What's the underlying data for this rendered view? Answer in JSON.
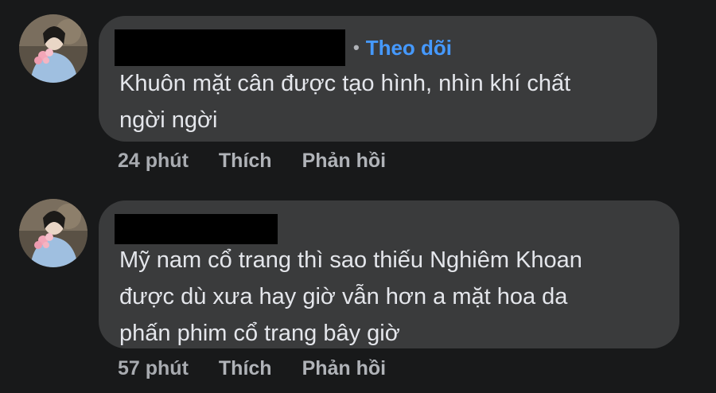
{
  "comments": [
    {
      "author_hidden": true,
      "follow_separator": "•",
      "follow_label": "Theo dõi",
      "text_lines": [
        "Khuôn mặt cân được tạo hình, nhìn khí chất",
        "ngời ngời"
      ],
      "time": "24 phút",
      "like_label": "Thích",
      "reply_label": "Phản hồi"
    },
    {
      "author_hidden": true,
      "text_lines": [
        "Mỹ nam cổ trang thì sao thiếu Nghiêm Khoan",
        "được dù xưa hay giờ vẫn hơn a mặt hoa da",
        "phấn phim cổ trang bây giờ"
      ],
      "time": "57 phút",
      "like_label": "Thích",
      "reply_label": "Phản hồi"
    }
  ],
  "colors": {
    "background": "#18191a",
    "bubble": "#3a3b3c",
    "text": "#e4e6eb",
    "muted": "#b0b3b8",
    "link": "#4599ff",
    "redaction": "#000000"
  }
}
